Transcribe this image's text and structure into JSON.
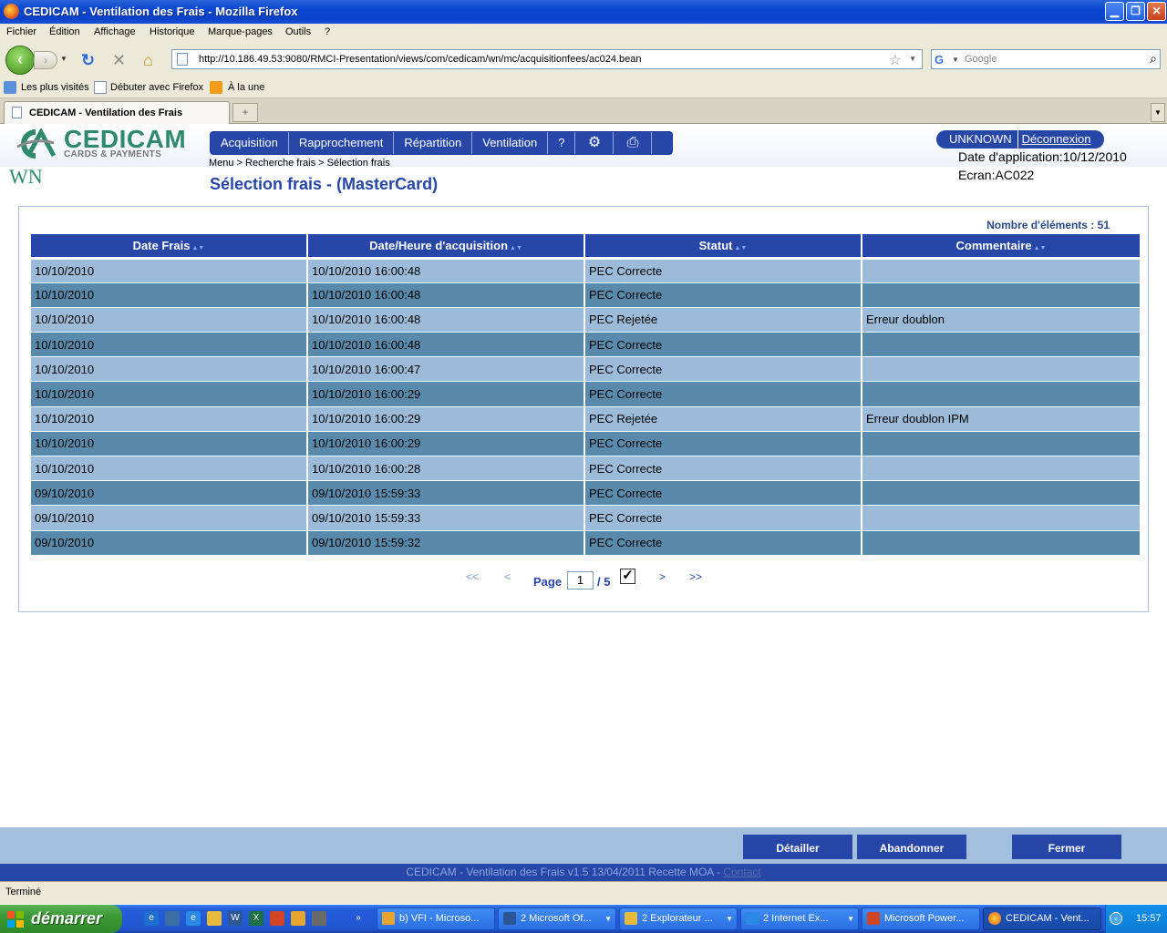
{
  "window": {
    "title": "CEDICAM - Ventilation des Frais - Mozilla Firefox"
  },
  "menubar": [
    "Fichier",
    "Édition",
    "Affichage",
    "Historique",
    "Marque-pages",
    "Outils",
    "?"
  ],
  "toolbar": {
    "url": "http://10.186.49.53:9080/RMCI-Presentation/views/com/cedicam/wn/mc/acquisitionfees/ac024.bean",
    "search_placeholder": "Google"
  },
  "bookmarks": [
    "Les plus visités",
    "Débuter avec Firefox",
    "À la une"
  ],
  "tabs": [
    {
      "label": "CEDICAM - Ventilation des Frais"
    }
  ],
  "app": {
    "logo_text": "CEDICAM",
    "logo_sub": "CARDS & PAYMENTS",
    "module": "WN",
    "menu": [
      "Acquisition",
      "Rapprochement",
      "Répartition",
      "Ventilation",
      "?"
    ],
    "breadcrumb": "Menu > Recherche frais > Sélection frais",
    "page_title": "Sélection frais - (MasterCard)",
    "user": "UNKNOWN",
    "logout": "Déconnexion",
    "app_date": "Date d'application:10/12/2010",
    "screen": "Ecran:AC022",
    "count": "Nombre d'éléments : 51"
  },
  "table": {
    "columns": [
      "Date Frais",
      "Date/Heure d'acquisition",
      "Statut",
      "Commentaire"
    ],
    "rows": [
      [
        "10/10/2010",
        "10/10/2010 16:00:48",
        "PEC Correcte",
        ""
      ],
      [
        "10/10/2010",
        "10/10/2010 16:00:48",
        "PEC Correcte",
        ""
      ],
      [
        "10/10/2010",
        "10/10/2010 16:00:48",
        "PEC Rejetée",
        "Erreur doublon"
      ],
      [
        "10/10/2010",
        "10/10/2010 16:00:48",
        "PEC Correcte",
        ""
      ],
      [
        "10/10/2010",
        "10/10/2010 16:00:47",
        "PEC Correcte",
        ""
      ],
      [
        "10/10/2010",
        "10/10/2010 16:00:29",
        "PEC Correcte",
        ""
      ],
      [
        "10/10/2010",
        "10/10/2010 16:00:29",
        "PEC Rejetée",
        "Erreur doublon IPM"
      ],
      [
        "10/10/2010",
        "10/10/2010 16:00:29",
        "PEC Correcte",
        ""
      ],
      [
        "10/10/2010",
        "10/10/2010 16:00:28",
        "PEC Correcte",
        ""
      ],
      [
        "09/10/2010",
        "09/10/2010 15:59:33",
        "PEC Correcte",
        ""
      ],
      [
        "09/10/2010",
        "09/10/2010 15:59:33",
        "PEC Correcte",
        ""
      ],
      [
        "09/10/2010",
        "09/10/2010 15:59:32",
        "PEC Correcte",
        ""
      ]
    ]
  },
  "pager": {
    "first": "<<",
    "prev": "<",
    "label": "Page",
    "current": "1",
    "total": "/ 5",
    "next": ">",
    "last": ">>"
  },
  "buttons": {
    "detail": "Détailler",
    "abandon": "Abandonner",
    "close": "Fermer"
  },
  "footer": {
    "text": "CEDICAM - Ventilation des Frais v1.5 13/04/2011 Recette MOA -",
    "contact": "Contact"
  },
  "status": "Terminé",
  "taskbar": {
    "start": "démarrer",
    "tasks": [
      "b) VFI - Microso...",
      "2 Microsoft Of...",
      "2 Explorateur ...",
      "2 Internet Ex...",
      "Microsoft Power...",
      "CEDICAM - Vent..."
    ],
    "clock": "15:57"
  },
  "colors": {
    "accent": "#2646a8",
    "row_light": "#9bbbd9",
    "row_dark": "#5a8aab",
    "logo_green": "#2e8a6a"
  }
}
